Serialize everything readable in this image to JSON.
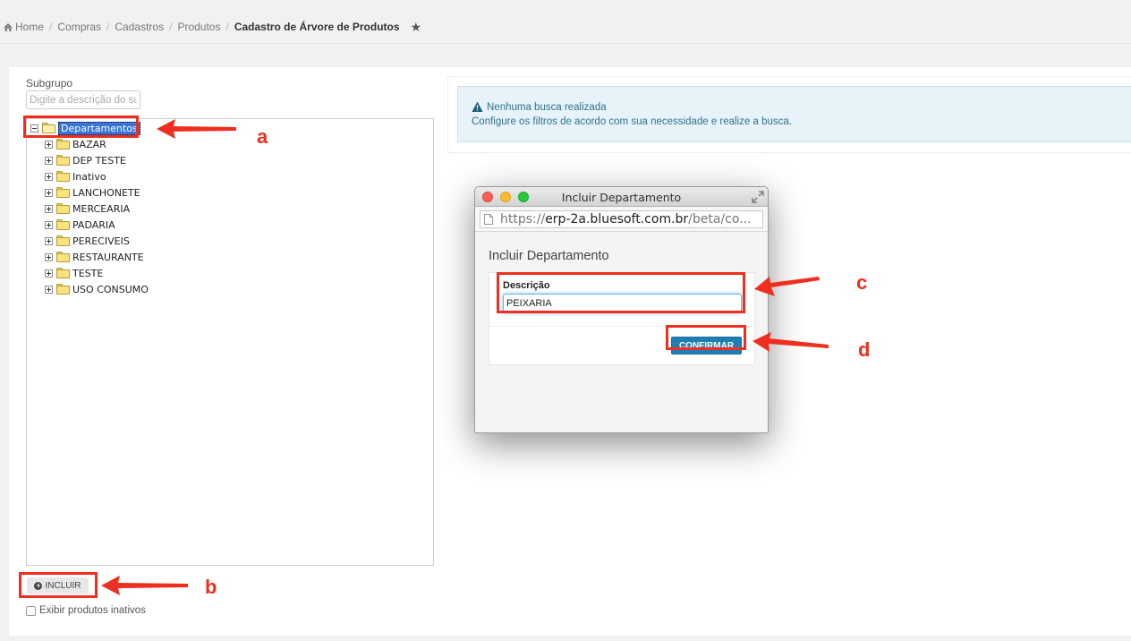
{
  "breadcrumb": {
    "items": [
      "Home",
      "Compras",
      "Cadastros",
      "Produtos"
    ],
    "current": "Cadastro de Árvore de Produtos",
    "separator": "/"
  },
  "filters": {
    "subgrupo_label": "Subgrupo",
    "subgrupo_placeholder": "Digite a descrição do subgrupo"
  },
  "tree": {
    "root": "Departamentos",
    "children": [
      "BAZAR",
      "DEP TESTE",
      "Inativo",
      "LANCHONETE",
      "MERCEARIA",
      "PADARIA",
      "PERECIVEIS",
      "RESTAURANTE",
      "TESTE",
      "USO CONSUMO"
    ]
  },
  "actions": {
    "incluir_label": "INCLUIR",
    "exibir_inativos_label": "Exibir produtos inativos"
  },
  "alert": {
    "title": "Nenhuma busca realizada",
    "text": "Configure os filtros de acordo com sua necessidade e realize a busca."
  },
  "popup": {
    "window_title": "Incluir Departamento",
    "url_prefix": "https://",
    "url_host": "erp-2a.bluesoft.com.br",
    "url_path": "/beta/co...",
    "heading": "Incluir Departamento",
    "descricao_label": "Descrição",
    "descricao_value": "PEIXARIA",
    "confirm_label": "CONFIRMAR"
  },
  "annotations": {
    "a": "a",
    "b": "b",
    "c": "c",
    "d": "d",
    "color": "#ee2e1e"
  },
  "colors": {
    "accent": "#1f7fb5",
    "selection": "#3875d7",
    "alert_bg": "#e7f3f8"
  },
  "icons": [
    "home-icon",
    "star-icon",
    "folder-icon",
    "expander-icon",
    "warning-icon",
    "plus-circle-icon",
    "document-icon",
    "expand-icon"
  ]
}
